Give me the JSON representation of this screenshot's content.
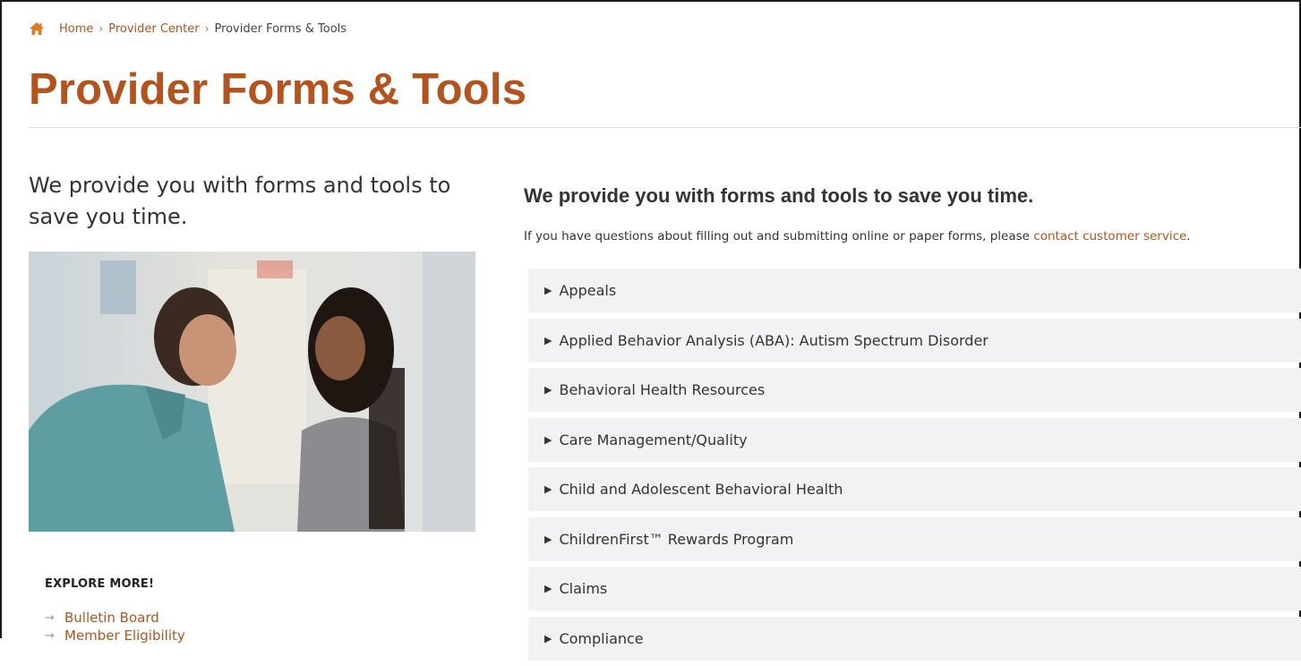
{
  "breadcrumb": {
    "home": "Home",
    "sep": "›",
    "parent": "Provider Center",
    "current": "Provider Forms & Tools"
  },
  "page": {
    "title": "Provider Forms & Tools"
  },
  "left": {
    "intro": "We provide you with forms and tools to save you time.",
    "explore_heading": "EXPLORE MORE!",
    "explore_links": [
      "Bulletin Board",
      "Member Eligibility"
    ]
  },
  "right": {
    "heading": "We provide you with forms and tools to save you time.",
    "sub_text": "If you have questions about filling out and submitting online or paper forms, please ",
    "sub_link": "contact customer service",
    "sub_end": ".",
    "accordion": [
      "Appeals",
      "Applied Behavior Analysis (ABA): Autism Spectrum Disorder",
      "Behavioral Health Resources",
      "Care Management/Quality",
      "Child and Adolescent Behavioral Health",
      "ChildrenFirst™ Rewards Program",
      "Claims",
      "Compliance"
    ]
  },
  "icons": {
    "home": "home-icon",
    "expand": "triangle-right-icon",
    "link_arrow": "arrow-right-icon"
  },
  "colors": {
    "brand": "#b3541e",
    "accordion_bg": "#f2f2f5",
    "text": "#333333"
  }
}
